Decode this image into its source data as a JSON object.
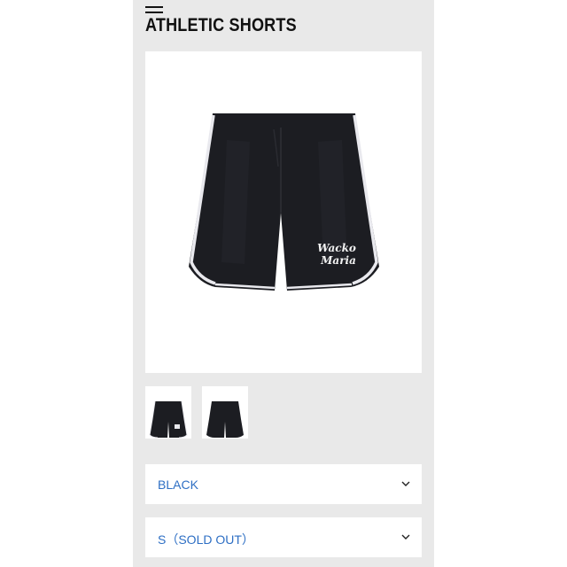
{
  "header": {
    "menu_icon": "hamburger-menu-icon",
    "title": "ATHLETIC SHORTS"
  },
  "product": {
    "logo_line1": "Wacko",
    "logo_line2": "Maria",
    "color_shorts": "#1c1d22",
    "color_piping": "#e9e9ee"
  },
  "thumbnails": [
    {
      "icon": "front-shorts-thumbnail"
    },
    {
      "icon": "back-shorts-thumbnail"
    }
  ],
  "options": {
    "color": {
      "value": "BLACK",
      "icon": "chevron-down-icon"
    },
    "size": {
      "value": "S（SOLD OUT）",
      "icon": "chevron-down-icon"
    }
  },
  "colors": {
    "accent": "#2e6fc4",
    "panel_background": "#e9e9e9"
  }
}
